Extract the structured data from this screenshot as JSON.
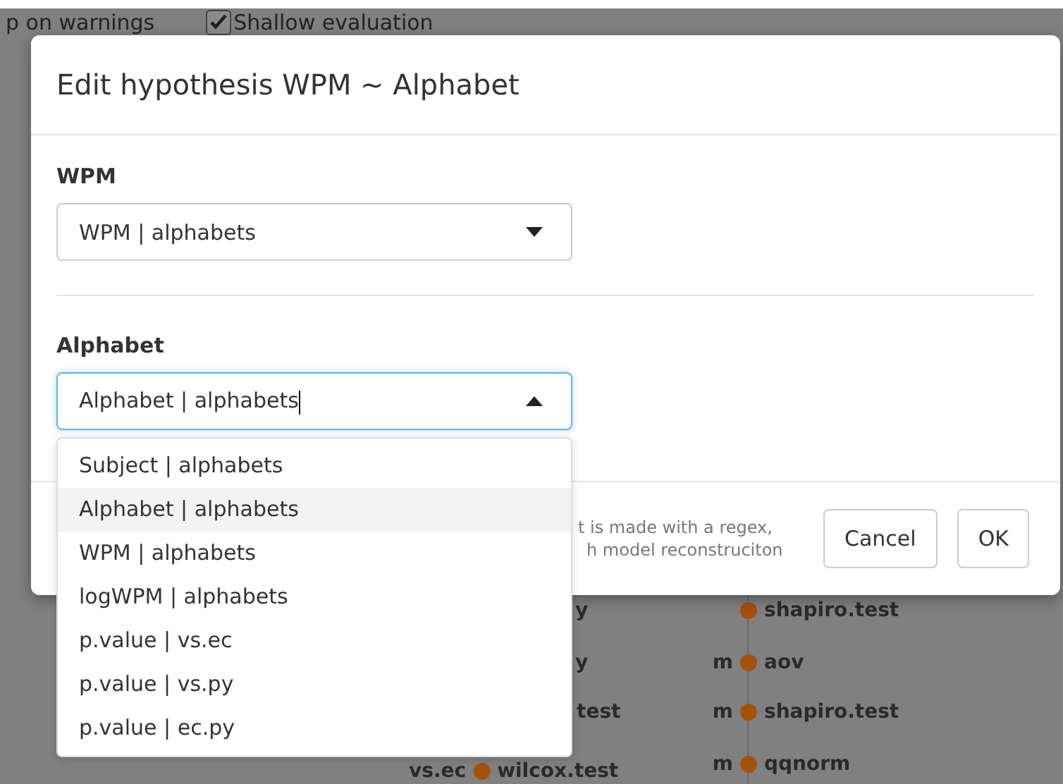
{
  "background": {
    "toolbar": [
      {
        "kind": "text",
        "label": "p on warnings"
      },
      {
        "kind": "checkbox",
        "label": "Shallow evaluation",
        "checked": true
      }
    ],
    "left_nodes": [
      {
        "label": "y",
        "dot": false
      },
      {
        "label": "y",
        "dot": false
      },
      {
        "label": "test",
        "dot": false
      },
      {
        "prefix": "vs.ec",
        "label": "wilcox.test",
        "dot": true
      }
    ],
    "right_nodes": [
      {
        "label": "shapiro.test"
      },
      {
        "prefix": "m",
        "label": "aov"
      },
      {
        "prefix": "m",
        "label": "shapiro.test"
      },
      {
        "prefix": "m",
        "label": "qqnorm"
      }
    ]
  },
  "dialog": {
    "title": "Edit hypothesis WPM ~ Alphabet",
    "fields": [
      {
        "label": "WPM",
        "value": "WPM | alphabets",
        "expanded": false
      },
      {
        "label": "Alphabet",
        "value": "Alphabet | alphabets",
        "expanded": true
      }
    ],
    "dropdown_options": [
      {
        "label": "Subject | alphabets",
        "selected": false
      },
      {
        "label": "Alphabet | alphabets",
        "selected": true
      },
      {
        "label": "WPM | alphabets",
        "selected": false
      },
      {
        "label": "logWPM | alphabets",
        "selected": false
      },
      {
        "label": "p.value | vs.ec",
        "selected": false
      },
      {
        "label": "p.value | vs.py",
        "selected": false
      },
      {
        "label": "p.value | ec.py",
        "selected": false
      }
    ],
    "footer_note": [
      "t is made with a regex,",
      "h model reconstruciton"
    ],
    "buttons": [
      "Cancel",
      "OK"
    ]
  }
}
